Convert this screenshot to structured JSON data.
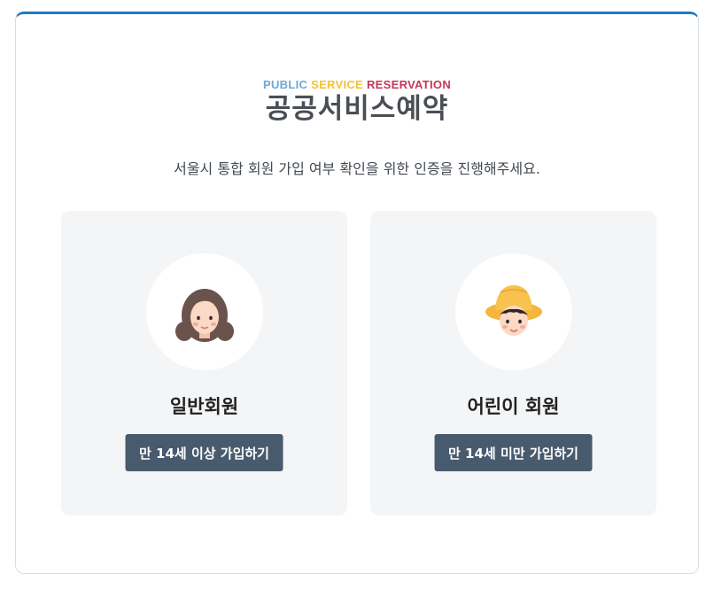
{
  "brand": {
    "eng_words": [
      "PUBLIC",
      "SERVICE",
      "RESERVATION"
    ],
    "kor": "공공서비스예약",
    "colors": {
      "public": "#6ea9d4",
      "service": "#f2c23a",
      "reservation": "#c4365c"
    }
  },
  "subtitle": "서울시 통합 회원 가입 여부 확인을 위한 인증을 진행해주세요.",
  "cards": [
    {
      "icon": "woman-avatar-icon",
      "title": "일반회원",
      "button_label": "만 14세 이상 가입하기"
    },
    {
      "icon": "child-avatar-icon",
      "title": "어린이 회원",
      "button_label": "만 14세 미만 가입하기"
    }
  ],
  "colors": {
    "accent": "#1f7ac7",
    "button": "#485a6e",
    "card_bg": "#f4f5f7"
  }
}
